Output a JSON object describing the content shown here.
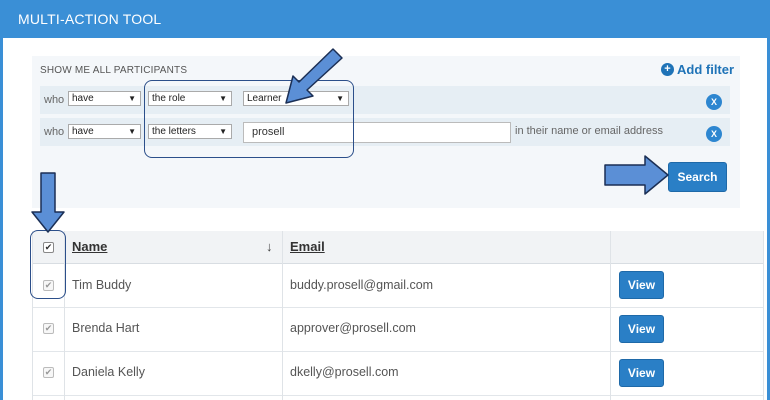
{
  "window": {
    "title": "MULTI-ACTION TOOL"
  },
  "filters": {
    "heading": "SHOW ME ALL PARTICIPANTS",
    "add_filter": "Add filter",
    "row1": {
      "who": "who",
      "condition": "have",
      "field": "the role",
      "value": "Learner"
    },
    "row2": {
      "who": "who",
      "condition": "have",
      "field": "the letters",
      "text_value": "prosell",
      "suffix": "in their name or email address"
    },
    "remove_label": "X",
    "search_label": "Search"
  },
  "table": {
    "headers": {
      "name": "Name",
      "email": "Email"
    },
    "sort_symbol": "↓",
    "check_symbol": "✔",
    "rows": [
      {
        "name": "Tim Buddy",
        "email": "buddy.prosell@gmail.com",
        "action": "View"
      },
      {
        "name": "Brenda Hart",
        "email": "approver@prosell.com",
        "action": "View"
      },
      {
        "name": "Daniela Kelly",
        "email": "dkelly@prosell.com",
        "action": "View"
      }
    ]
  },
  "colors": {
    "accent": "#3a8fd6",
    "button": "#2a7fc6",
    "arrow_fill": "#5b8fd6",
    "arrow_stroke": "#1b2f55"
  }
}
